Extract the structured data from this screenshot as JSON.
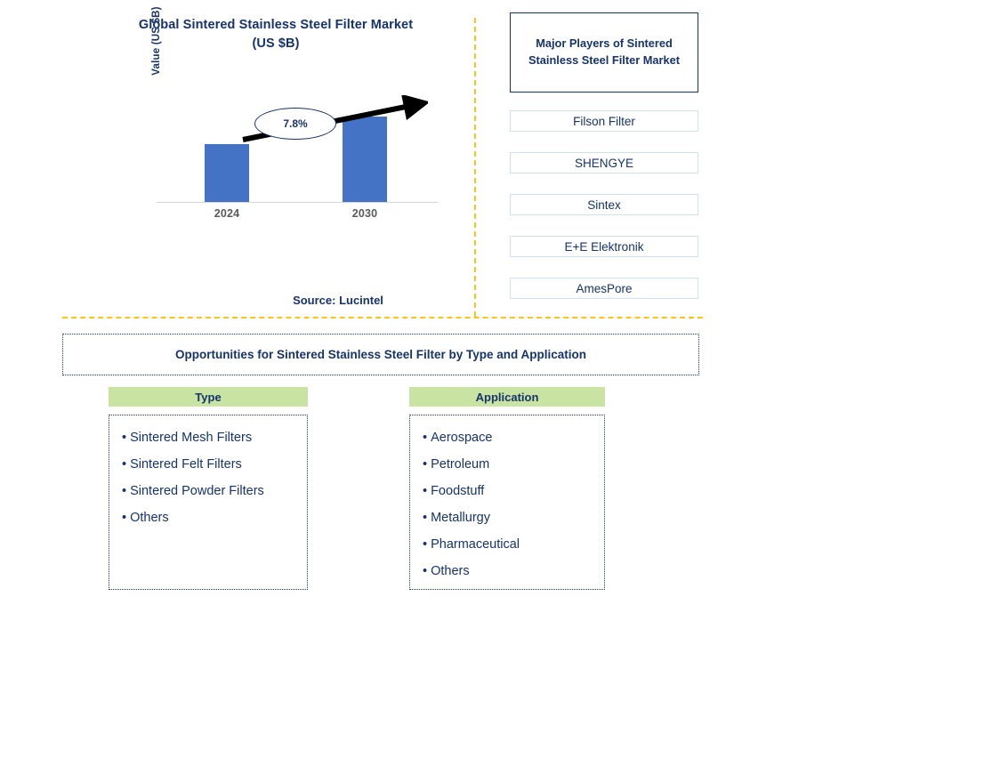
{
  "chart_panel": {
    "title_line1": "Global Sintered Stainless Steel Filter Market",
    "title_line2": "(US $B)",
    "source": "Source: Lucintel"
  },
  "chart_data": {
    "type": "bar",
    "title": "Global Sintered Stainless Steel Filter Market (US $B)",
    "xlabel": "",
    "ylabel": "Value (US $B)",
    "categories": [
      "2024",
      "2030"
    ],
    "values": [
      53,
      79
    ],
    "ylim": [
      0,
      100
    ],
    "grid": false,
    "legend": null,
    "bar_color": "#4472C4",
    "annotations": [
      {
        "name": "cagr-callout",
        "text": "7.8%",
        "description": "growth arrow from 2024 bar to 2030 bar with CAGR label"
      }
    ]
  },
  "players_panel": {
    "header": "Major Players of Sintered Stainless Steel Filter Market",
    "items": [
      {
        "label": "Filson Filter"
      },
      {
        "label": "SHENGYE"
      },
      {
        "label": "Sintex"
      },
      {
        "label": "E+E Elektronik"
      },
      {
        "label": "AmesPore"
      }
    ]
  },
  "opportunities": {
    "banner": "Opportunities for Sintered Stainless Steel Filter by Type and Application",
    "columns": [
      {
        "header": "Type",
        "items": [
          "Sintered Mesh Filters",
          "Sintered Felt Filters",
          "Sintered Powder Filters",
          "Others"
        ]
      },
      {
        "header": "Application",
        "items": [
          "Aerospace",
          "Petroleum",
          "Foodstuff",
          "Metallurgy",
          "Pharmaceutical",
          "Others"
        ]
      }
    ]
  },
  "colors": {
    "navy": "#16336B",
    "bar_blue": "#4472C4",
    "divider_gold": "#FCC419",
    "header_green": "#C9E3A3",
    "player_border": "#CFE2F3"
  }
}
